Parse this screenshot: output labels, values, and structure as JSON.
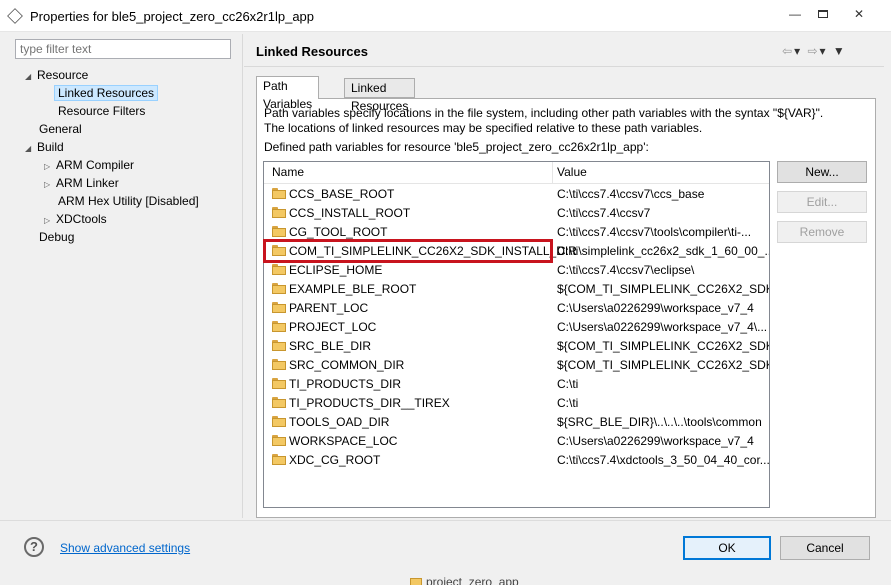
{
  "window": {
    "title": "Properties for ble5_project_zero_cc26x2r1lp_app",
    "minimize_glyph": "—",
    "close_glyph": "✕"
  },
  "filter": {
    "placeholder": "type filter text"
  },
  "tree": [
    {
      "label": "Resource",
      "expander": "◢"
    },
    {
      "label": "Linked Resources",
      "selected": true
    },
    {
      "label": "Resource Filters"
    },
    {
      "label": "General"
    },
    {
      "label": "Build",
      "expander": "◢"
    },
    {
      "label": "ARM Compiler",
      "expander": "▷"
    },
    {
      "label": "ARM Linker",
      "expander": "▷"
    },
    {
      "label": "ARM Hex Utility  [Disabled]"
    },
    {
      "label": "XDCtools",
      "expander": "▷"
    },
    {
      "label": "Debug"
    }
  ],
  "page": {
    "title": "Linked Resources",
    "nav": {
      "back": "⇦",
      "forward": "⇨",
      "dropdown": "▾",
      "menu": "▼"
    }
  },
  "tabs": [
    {
      "label": "Path Variables",
      "active": true
    },
    {
      "label": "Linked Resources",
      "active": false
    }
  ],
  "description": {
    "line1": "Path variables specify locations in the file system, including other path variables with the syntax \"${VAR}\".",
    "line2": "The locations of linked resources may be specified relative to these path variables.",
    "defined": "Defined path variables for resource 'ble5_project_zero_cc26x2r1lp_app':"
  },
  "table": {
    "columns": [
      "Name",
      "Value"
    ],
    "rows": [
      {
        "name": "CCS_BASE_ROOT",
        "value": "C:\\ti\\ccs7.4\\ccsv7\\ccs_base"
      },
      {
        "name": "CCS_INSTALL_ROOT",
        "value": "C:\\ti\\ccs7.4\\ccsv7"
      },
      {
        "name": "CG_TOOL_ROOT",
        "value": "C:\\ti\\ccs7.4\\ccsv7\\tools\\compiler\\ti-..."
      },
      {
        "name": "COM_TI_SIMPLELINK_CC26X2_SDK_INSTALL_DIR",
        "value": "C:\\ti\\simplelink_cc26x2_sdk_1_60_00_..."
      },
      {
        "name": "ECLIPSE_HOME",
        "value": "C:\\ti\\ccs7.4\\ccsv7\\eclipse\\"
      },
      {
        "name": "EXAMPLE_BLE_ROOT",
        "value": "${COM_TI_SIMPLELINK_CC26X2_SDK..."
      },
      {
        "name": "PARENT_LOC",
        "value": "C:\\Users\\a0226299\\workspace_v7_4"
      },
      {
        "name": "PROJECT_LOC",
        "value": "C:\\Users\\a0226299\\workspace_v7_4\\..."
      },
      {
        "name": "SRC_BLE_DIR",
        "value": "${COM_TI_SIMPLELINK_CC26X2_SDK..."
      },
      {
        "name": "SRC_COMMON_DIR",
        "value": "${COM_TI_SIMPLELINK_CC26X2_SDK..."
      },
      {
        "name": "TI_PRODUCTS_DIR",
        "value": "C:\\ti"
      },
      {
        "name": "TI_PRODUCTS_DIR__TIREX",
        "value": "C:\\ti"
      },
      {
        "name": "TOOLS_OAD_DIR",
        "value": "${SRC_BLE_DIR}\\..\\..\\..\\tools\\common"
      },
      {
        "name": "WORKSPACE_LOC",
        "value": "C:\\Users\\a0226299\\workspace_v7_4"
      },
      {
        "name": "XDC_CG_ROOT",
        "value": "C:\\ti\\ccs7.4\\xdctools_3_50_04_40_cor..."
      }
    ]
  },
  "buttons": {
    "new": "New...",
    "edit": "Edit...",
    "remove": "Remove",
    "ok": "OK",
    "cancel": "Cancel"
  },
  "footer": {
    "help": "?",
    "advanced_link": "Show advanced settings",
    "underneath_text": "project_zero_app"
  },
  "colors": {
    "highlight_border": "#c8141e",
    "selection": "#cce8ff",
    "link": "#0066cc"
  }
}
